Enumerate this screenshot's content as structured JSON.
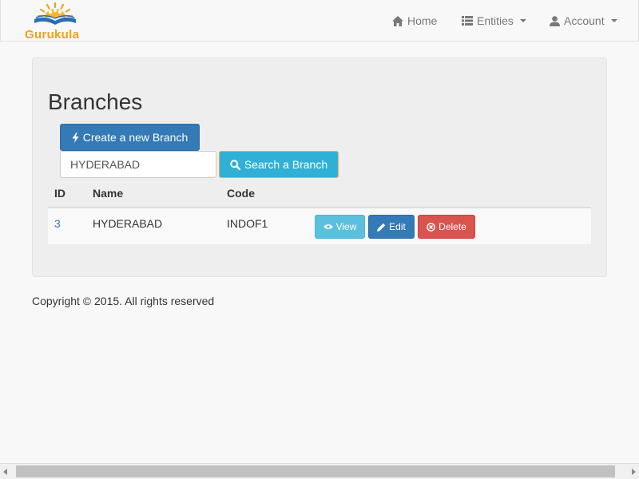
{
  "navbar": {
    "brand": "Gurukula",
    "home_label": "Home",
    "entities_label": "Entities",
    "account_label": "Account"
  },
  "main": {
    "title": "Branches",
    "create_button": "Create a new Branch",
    "search": {
      "value": "HYDERABAD",
      "button": "Search a Branch"
    },
    "table": {
      "headers": [
        "ID",
        "Name",
        "Code"
      ],
      "rows": [
        {
          "id": "3",
          "name": "HYDERABAD",
          "code": "INDOF1",
          "view_label": "View",
          "edit_label": "Edit",
          "delete_label": "Delete"
        }
      ]
    }
  },
  "footer": {
    "copyright": "Copyright © 2015. All rights reserved"
  },
  "colors": {
    "primary": "#337ab7",
    "info": "#5bc0de",
    "search": "#31b0d5",
    "danger": "#d9534f",
    "brand": "#f0a020"
  },
  "icons": {
    "home": "home-icon",
    "entities": "list-icon",
    "account": "user-icon",
    "create": "bolt-icon",
    "search": "search-icon",
    "view": "eye-icon",
    "edit": "pencil-icon",
    "delete": "remove-circle-icon"
  }
}
